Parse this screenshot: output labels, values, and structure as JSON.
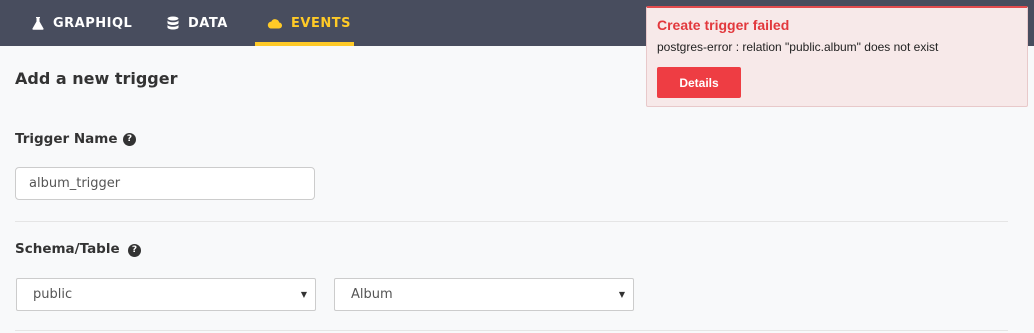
{
  "nav": {
    "items": [
      {
        "label": "GRAPHIQL",
        "icon": "flask-icon",
        "active": false
      },
      {
        "label": "DATA",
        "icon": "database-icon",
        "active": false
      },
      {
        "label": "EVENTS",
        "icon": "cloud-icon",
        "active": true
      }
    ],
    "active_color": "#ffca27",
    "background": "#484d5e"
  },
  "page": {
    "title": "Add a new trigger"
  },
  "form": {
    "trigger_name_label": "Trigger Name",
    "trigger_name_value": "album_trigger",
    "schema_table_label": "Schema/Table",
    "schema_selected": "public",
    "table_selected": "Album",
    "help_glyph": "?"
  },
  "toast": {
    "title": "Create trigger failed",
    "message": "postgres-error : relation \"public.album\" does not exist",
    "button_label": "Details",
    "accent": "#e2383d"
  }
}
